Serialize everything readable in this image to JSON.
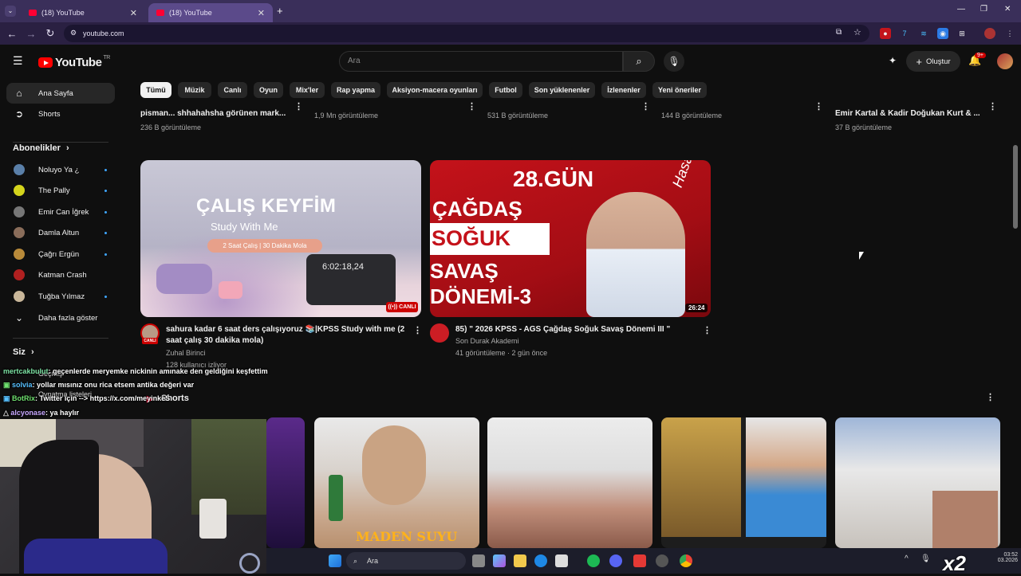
{
  "browser": {
    "tabs": [
      {
        "title": "(18) YouTube"
      },
      {
        "title": "(18) YouTube"
      }
    ],
    "url": "youtube.com"
  },
  "header": {
    "logo": "YouTube",
    "logo_sup": "TR",
    "search_placeholder": "Ara",
    "create_label": "Oluştur",
    "notif_badge": "9+"
  },
  "sidebar": {
    "main": [
      {
        "label": "Ana Sayfa",
        "icon": "home-icon"
      },
      {
        "label": "Shorts",
        "icon": "shorts-icon"
      }
    ],
    "subs_heading": "Abonelikler",
    "subs": [
      {
        "label": "Noluyo Ya ¿",
        "color": "#5a7fa8"
      },
      {
        "label": "The Pally",
        "color": "#d4d41c"
      },
      {
        "label": "Emir Can İğrek",
        "color": "#777"
      },
      {
        "label": "Damla Altun",
        "color": "#8a6d5a"
      },
      {
        "label": "Çağrı Ergün",
        "color": "#b88a3a"
      },
      {
        "label": "Katman Crash",
        "color": "#b02020"
      },
      {
        "label": "Tuğba Yılmaz",
        "color": "#c9b79a"
      }
    ],
    "more": "Daha fazla göster",
    "you_heading": "Siz",
    "you_items": [
      "Geçmiş",
      "Oynatma listeleri"
    ]
  },
  "chips": [
    "Tümü",
    "Müzik",
    "Canlı",
    "Oyun",
    "Mix'ler",
    "Rap yapma",
    "Aksiyon-macera oyunları",
    "Futbol",
    "Son yüklenenler",
    "İzlenenler",
    "Yeni öneriler"
  ],
  "top_row": {
    "titles": [
      "pisman... shhahahsha görünen mark...",
      "",
      "",
      "",
      "Emir Kartal & Kadir Doğukan Kurt & ..."
    ],
    "metas": [
      "236 B görüntüleme",
      "1,9 Mn görüntüleme",
      "531 B görüntüleme",
      "144 B görüntüleme",
      "37 B görüntüleme"
    ]
  },
  "videos": [
    {
      "thumb_title": "ÇALIŞ KEYFİM",
      "thumb_sub": "Study With Me",
      "thumb_pill": "2 Saat Çalış | 30 Dakika Mola",
      "thumb_clock": "6:02:18,24",
      "badge": "CANLI",
      "avatar_badge": "CANLI",
      "title_line1": "sahura kadar 6 saat ders çalışıyoruz 📚|KPSS Study with me  (2",
      "title_line2": "saat çalış 30 dakika mola)",
      "channel": "Zuhal Birinci",
      "meta": "128 kullanıcı izliyor"
    },
    {
      "thumb_day": "28.GÜN",
      "thumb_l1": "ÇAĞDAŞ",
      "thumb_l2": "SOĞUK",
      "thumb_l3": "SAVAŞ",
      "thumb_l4": "DÖNEMİ-3",
      "thumb_sig": "Hasan Topbay",
      "duration": "26:24",
      "title": "85)  \" 2026 KPSS - AGS Çağdaş Soğuk Savaş Dönemi III \"",
      "channel": "Son Durak Akademi",
      "meta": "41 görüntüleme · 2 gün önce"
    }
  ],
  "chat": [
    {
      "user": "mertcakbulut",
      "msg": ": geçenlerde meryemke nickinin amınake den geldiğini keşfettim"
    },
    {
      "user": "solvia",
      "msg": ": yollar mısınız onu rica etsem antika değeri var"
    },
    {
      "user": "BotRix",
      "msg": ": Twitter için --> https://x.com/meyinkeS"
    },
    {
      "user": "alcyonase",
      "msg": ": ya haylır"
    }
  ],
  "shorts": {
    "heading": "Shorts",
    "short2_text": "MADEN SUYU"
  },
  "taskbar": {
    "search": "Ara",
    "time": "03:52",
    "date": "03.2026",
    "overlay": "x2"
  }
}
